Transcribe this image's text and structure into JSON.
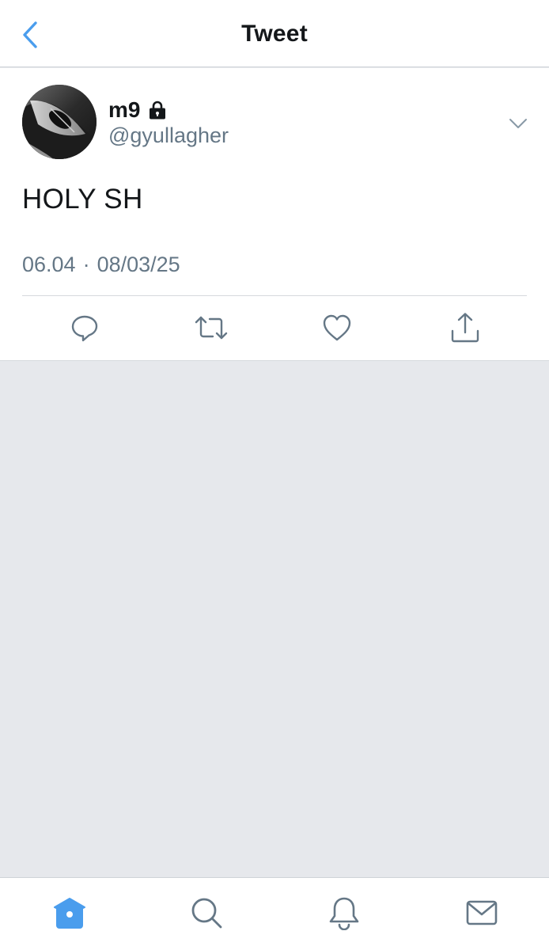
{
  "nav": {
    "title": "Tweet",
    "back_icon": "chevron-left-icon"
  },
  "tweet": {
    "display_name": "m9",
    "protected_icon": "lock-icon",
    "handle": "@gyullagher",
    "text": "HOLY SH",
    "time": "06.04",
    "separator": "·",
    "date": "08/03/25",
    "actions": [
      "reply-icon",
      "retweet-icon",
      "like-icon",
      "share-icon"
    ]
  },
  "tabbar": {
    "tabs": [
      "home-icon",
      "search-icon",
      "notifications-icon",
      "messages-icon"
    ],
    "active": "home-icon"
  },
  "colors": {
    "accent": "#4a9ded",
    "text": "#14171a",
    "secondary": "#657786",
    "background": "#e6e8ec",
    "surface": "#ffffff"
  }
}
